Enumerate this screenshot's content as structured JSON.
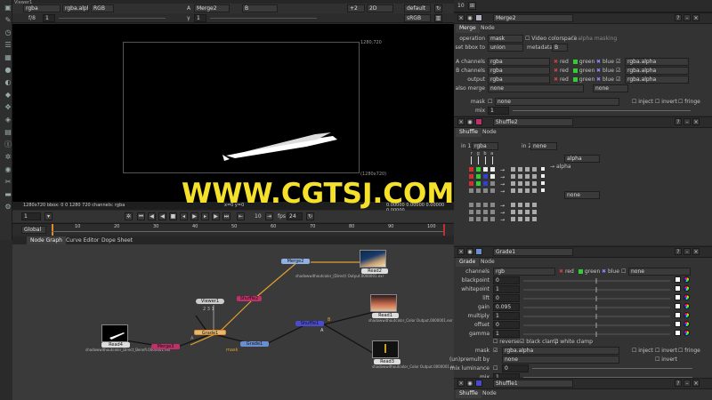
{
  "viewer_top": {
    "layer": "rgba",
    "channel": "rgba.alpha",
    "colorspace": "RGB",
    "input_a": "A",
    "input_a_node": "Merge2",
    "input_b": "B",
    "zoom": "+2",
    "view": "2D",
    "lut": "default",
    "gain": "1",
    "gamma": "1",
    "display": "sRGB",
    "viewer_lut": "sRGB"
  },
  "viewer": {
    "format_top": "1280,720",
    "format_bottom": "(1280x720)",
    "info_text": "1280x720 bbox: 0 0 1280 720 channels: rgba",
    "info_right": "x=0 y=0",
    "info_right2": "0.00000 0.00000 0.00000 0.00000"
  },
  "timeline": {
    "frame": "1",
    "fps_label": "fps",
    "fps": "24",
    "step": "10",
    "scope": "Global",
    "ticks": [
      "10",
      "20",
      "30",
      "40",
      "50",
      "60",
      "70",
      "80",
      "90",
      "100"
    ],
    "end": "100"
  },
  "graph_tabs": [
    "Node Graph",
    "Curve Editor",
    "Dope Sheet"
  ],
  "nodes": {
    "read4": "Read4",
    "read4_file": "shadowwithoutcolor_Direct_Benefi.0000001.exr",
    "read2": "Read2",
    "read2_file": "shadowwithoutcolor_(Direct) Output.0000001.exr",
    "read1": "Read1",
    "read1_file": "shadowwithoutcolor_Color Output.0000001.exr",
    "read3": "Read3",
    "read3_file": "shadowwithoutcolor_Color Output.0000001.exr",
    "viewer1": "Viewer1",
    "viewer1_inputs": "2  3  1",
    "shuffle2": "Shuffle2",
    "merge2": "Merge2",
    "grade1": "Grade1",
    "shuffle1": "Shuffle1",
    "merge3": "Merge3",
    "mask_label": "mask",
    "a_label": "A",
    "b_label": "B"
  },
  "watermark": "WWW.CGTSJ.COM",
  "properties": {
    "count": "10",
    "merge": {
      "title": "Merge2",
      "tabs": [
        "Merge",
        "Node"
      ],
      "operation_label": "operation",
      "operation": "mask",
      "video_colorspace": "Video colorspace",
      "alpha_masking": "alpha masking",
      "bbox_label": "set bbox to",
      "bbox": "union",
      "metadata_label": "metadata from",
      "metadata": "B",
      "a_channels_label": "A channels",
      "a_channels": "rgba",
      "b_channels_label": "B channels",
      "b_channels": "rgba",
      "output_label": "output",
      "output": "rgba",
      "also_merge_label": "also merge",
      "also_merge": "none",
      "also_merge2": "none",
      "red": "red",
      "green": "green",
      "blue": "blue",
      "alpha_a": "rgba.alpha",
      "alpha_b": "rgba.alpha",
      "alpha_out": "rgba.alpha",
      "mask_label": "mask",
      "mask": "none",
      "inject": "inject",
      "invert": "invert",
      "fringe": "fringe",
      "mix_label": "mix",
      "mix": "1"
    },
    "shuffle": {
      "title": "Shuffle2",
      "tabs": [
        "Shuffle",
        "Node"
      ],
      "in1_label": "in 1",
      "in1": "rgba",
      "in2_label": "in 2",
      "in2": "none",
      "rgba_header": "r g b a",
      "out_alpha": "alpha",
      "out_alpha_label": "alpha",
      "out2": "none"
    },
    "grade": {
      "title": "Grade1",
      "tabs": [
        "Grade",
        "Node"
      ],
      "channels_label": "channels",
      "channels": "rgb",
      "red": "red",
      "green": "green",
      "blue": "blue",
      "extra": "none",
      "rows": [
        {
          "label": "blackpoint",
          "value": "0"
        },
        {
          "label": "whitepoint",
          "value": "1"
        },
        {
          "label": "lift",
          "value": "0"
        },
        {
          "label": "gain",
          "value": "0.095"
        },
        {
          "label": "multiply",
          "value": "1"
        },
        {
          "label": "offset",
          "value": "0"
        },
        {
          "label": "gamma",
          "value": "1"
        }
      ],
      "reverse": "reverse",
      "black_clamp": "black clamp",
      "white_clamp": "white clamp",
      "mask_label": "mask",
      "mask": "rgba.alpha",
      "inject": "inject",
      "invert": "invert",
      "fringe": "fringe",
      "unpremult_label": "(un)premult by",
      "unpremult": "none",
      "invert2": "invert",
      "mix_lum_label": "mix luminance",
      "mix_lum": "0",
      "mix_label": "mix",
      "mix": "1"
    },
    "shuffle1": {
      "title": "Shuffle1",
      "tabs": [
        "Shuffle",
        "Node"
      ]
    }
  },
  "colors": {
    "viewer_bg": "#000000",
    "accent_orange": "#e08a2a",
    "watermark": "#f5e02a",
    "node_pink": "#c0306a",
    "node_blue": "#6a8fd0",
    "node_purple": "#4a4ad0"
  }
}
